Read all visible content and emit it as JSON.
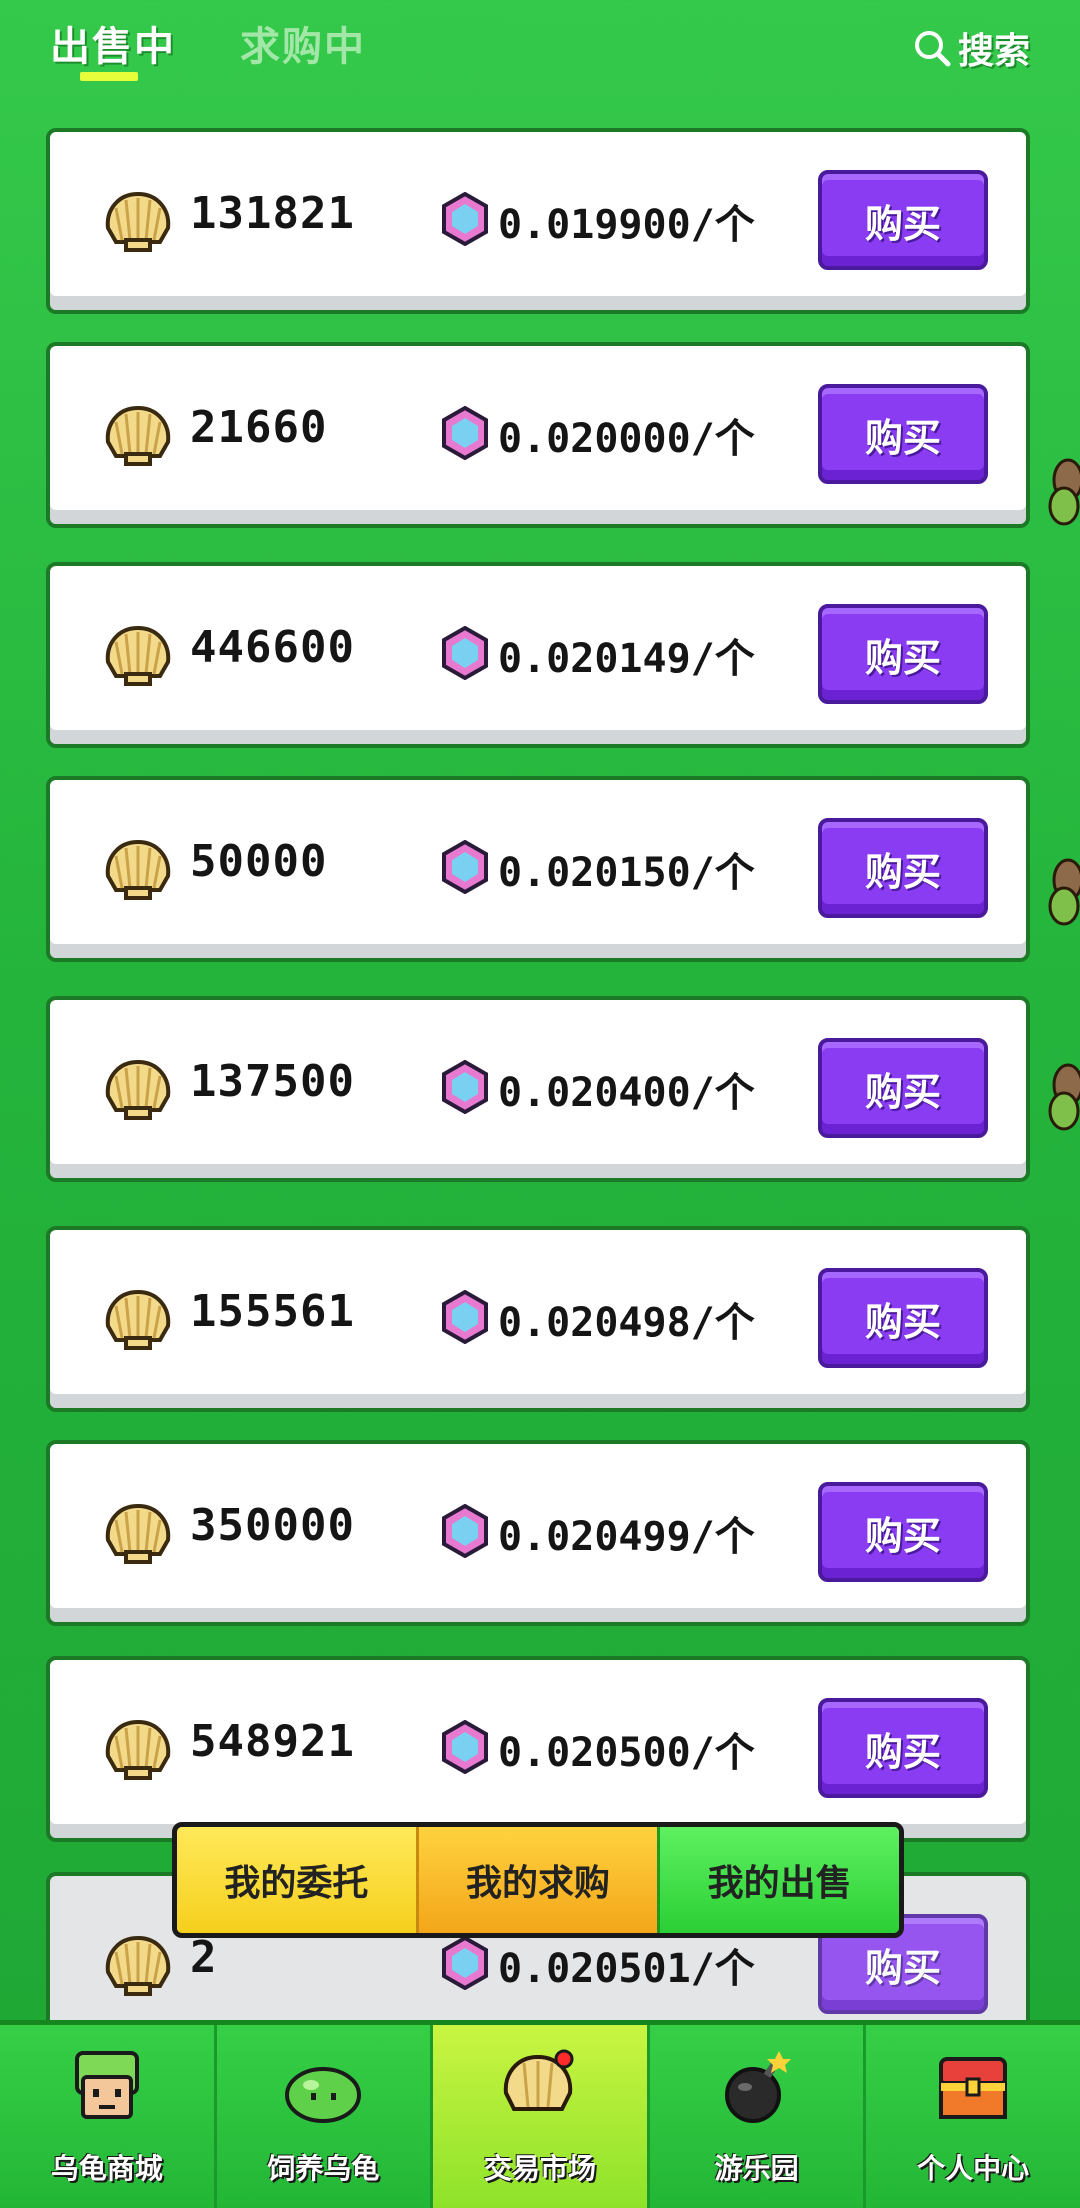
{
  "header": {
    "tabs": [
      {
        "label": "出售中",
        "active": true
      },
      {
        "label": "求购中",
        "active": false
      }
    ],
    "search_label": "搜索"
  },
  "listings": [
    {
      "quantity": "131821",
      "price": "0.019900/个",
      "buy_label": "购买"
    },
    {
      "quantity": "21660",
      "price": "0.020000/个",
      "buy_label": "购买"
    },
    {
      "quantity": "446600",
      "price": "0.020149/个",
      "buy_label": "购买"
    },
    {
      "quantity": "50000",
      "price": "0.020150/个",
      "buy_label": "购买"
    },
    {
      "quantity": "137500",
      "price": "0.020400/个",
      "buy_label": "购买"
    },
    {
      "quantity": "155561",
      "price": "0.020498/个",
      "buy_label": "购买"
    },
    {
      "quantity": "350000",
      "price": "0.020499/个",
      "buy_label": "购买"
    },
    {
      "quantity": "548921",
      "price": "0.020500/个",
      "buy_label": "购买"
    },
    {
      "quantity": "2",
      "price": "0.020501/个",
      "buy_label": "购买"
    }
  ],
  "segment": {
    "items": [
      "我的委托",
      "我的求购",
      "我的出售"
    ]
  },
  "nav": {
    "items": [
      {
        "label": "乌龟商城",
        "icon": "turtle-shop-icon"
      },
      {
        "label": "饲养乌龟",
        "icon": "slime-turtle-icon"
      },
      {
        "label": "交易市场",
        "icon": "shell-market-icon",
        "active": true
      },
      {
        "label": "游乐园",
        "icon": "bomb-icon"
      },
      {
        "label": "个人中心",
        "icon": "treasure-chest-icon"
      }
    ]
  },
  "colors": {
    "background": "#2ab93f",
    "buy_button": "#8a3cf2",
    "active_nav": "#b6ee38",
    "tab_underline": "#e6ff3a"
  }
}
